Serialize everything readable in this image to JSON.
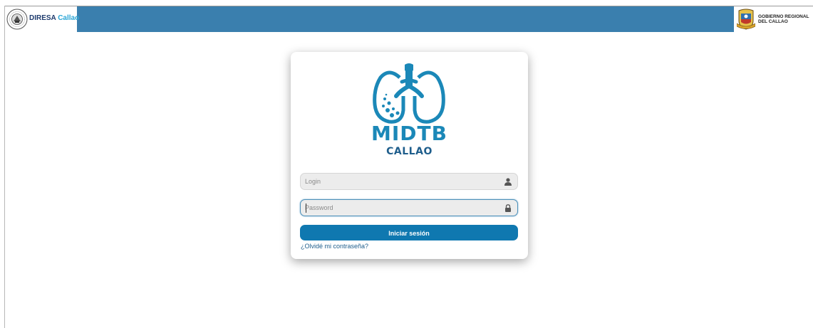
{
  "header": {
    "brand": {
      "name_primary": "DIRESA",
      "name_secondary": "Callao",
      "logo_icon": "diresa-seal-icon"
    },
    "government": {
      "crest_icon": "gobierno-regional-crest-icon",
      "line1": "GOBIERNO REGIONAL",
      "line2": "DEL CALLAO"
    },
    "bar_color": "#3a7fae"
  },
  "login_card": {
    "logo": {
      "icon": "lungs-logo-icon",
      "title": "MIDTB",
      "subtitle": "CALLAO"
    },
    "login_field": {
      "placeholder": "Login",
      "value": "",
      "icon": "user-icon"
    },
    "password_field": {
      "placeholder": "Password",
      "value": "",
      "icon": "lock-icon"
    },
    "submit_label": "Iniciar sesión",
    "forgot_label": "¿Olvidé mi contraseña?",
    "accent_color": "#0f78b0"
  }
}
